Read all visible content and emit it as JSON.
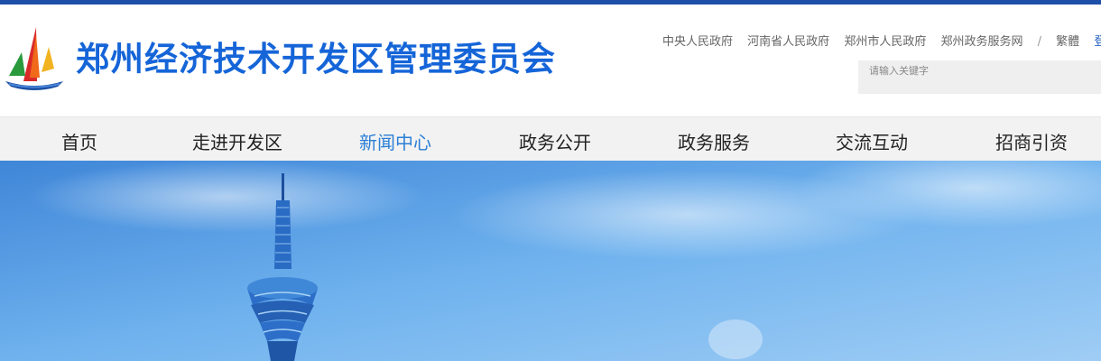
{
  "header": {
    "title": "郑州经济技术开发区管理委员会",
    "logo_icon": "sailboat-logo-icon"
  },
  "toplinks": {
    "items": [
      "中央人民政府",
      "河南省人民政府",
      "郑州市人民政府",
      "郑州政务服务网"
    ],
    "separator": "/",
    "traditional": "繁體",
    "login": "登录"
  },
  "search": {
    "placeholder": "请输入关键字"
  },
  "nav": {
    "items": [
      {
        "label": "首页"
      },
      {
        "label": "走进开发区"
      },
      {
        "label": "新闻中心"
      },
      {
        "label": "政务公开"
      },
      {
        "label": "政务服务"
      },
      {
        "label": "交流互动"
      },
      {
        "label": "招商引资"
      }
    ],
    "active_index": 2
  },
  "colors": {
    "brand_blue": "#1565d8",
    "top_bar": "#1e4fa8",
    "nav_active": "#2a7fd6",
    "sky": "#5fa8e8"
  }
}
